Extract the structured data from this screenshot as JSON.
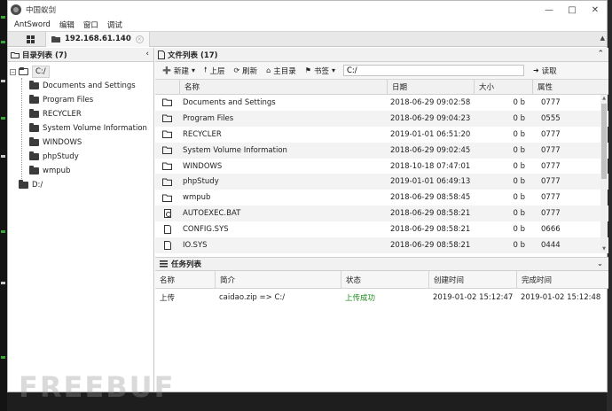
{
  "window": {
    "title": "中国蚁剑"
  },
  "menu": [
    "AntSword",
    "编辑",
    "窗口",
    "调试"
  ],
  "tabs": {
    "active": "192.168.61.140"
  },
  "left_panel": {
    "title": "目录列表 (7)",
    "drive_c": "C:/",
    "drive_d": "D:/",
    "folders": [
      "Documents and Settings",
      "Program Files",
      "RECYCLER",
      "System Volume Information",
      "WINDOWS",
      "phpStudy",
      "wmpub"
    ]
  },
  "file_panel": {
    "title": "文件列表 (17)",
    "toolbar": {
      "new": "新建",
      "up": "上层",
      "refresh": "刷新",
      "home": "主目录",
      "bookmark": "书签",
      "path": "C:/",
      "read": "读取"
    },
    "columns": [
      "名称",
      "日期",
      "大小",
      "属性"
    ],
    "rows": [
      {
        "icon": "folder-icon",
        "name": "Documents and Settings",
        "date": "2018-06-29 09:02:58",
        "size": "0 b",
        "attr": "0777"
      },
      {
        "icon": "folder-icon",
        "name": "Program Files",
        "date": "2018-06-29 09:04:23",
        "size": "0 b",
        "attr": "0555"
      },
      {
        "icon": "folder-icon",
        "name": "RECYCLER",
        "date": "2019-01-01 06:51:20",
        "size": "0 b",
        "attr": "0777"
      },
      {
        "icon": "folder-icon",
        "name": "System Volume Information",
        "date": "2018-06-29 09:02:45",
        "size": "0 b",
        "attr": "0777"
      },
      {
        "icon": "folder-icon",
        "name": "WINDOWS",
        "date": "2018-10-18 07:47:01",
        "size": "0 b",
        "attr": "0777"
      },
      {
        "icon": "folder-icon",
        "name": "phpStudy",
        "date": "2019-01-01 06:49:13",
        "size": "0 b",
        "attr": "0777"
      },
      {
        "icon": "folder-icon",
        "name": "wmpub",
        "date": "2018-06-29 08:58:45",
        "size": "0 b",
        "attr": "0777"
      },
      {
        "icon": "bat-file-icon",
        "name": "AUTOEXEC.BAT",
        "date": "2018-06-29 08:58:21",
        "size": "0 b",
        "attr": "0777"
      },
      {
        "icon": "file-icon",
        "name": "CONFIG.SYS",
        "date": "2018-06-29 08:58:21",
        "size": "0 b",
        "attr": "0666"
      },
      {
        "icon": "file-icon",
        "name": "IO.SYS",
        "date": "2018-06-29 08:58:21",
        "size": "0 b",
        "attr": "0444"
      }
    ]
  },
  "task_panel": {
    "title": "任务列表",
    "columns": [
      "名称",
      "简介",
      "状态",
      "创建时间",
      "完成时间"
    ],
    "rows": [
      {
        "name": "上传",
        "desc": "caidao.zip => C:/",
        "status": "上传成功",
        "created": "2019-01-02 15:12:47",
        "finished": "2019-01-02 15:12:48"
      }
    ]
  },
  "watermark": "FREEBUF",
  "colors": {
    "status_success": "#1c8a1c",
    "terminal_bg": "#141414"
  }
}
